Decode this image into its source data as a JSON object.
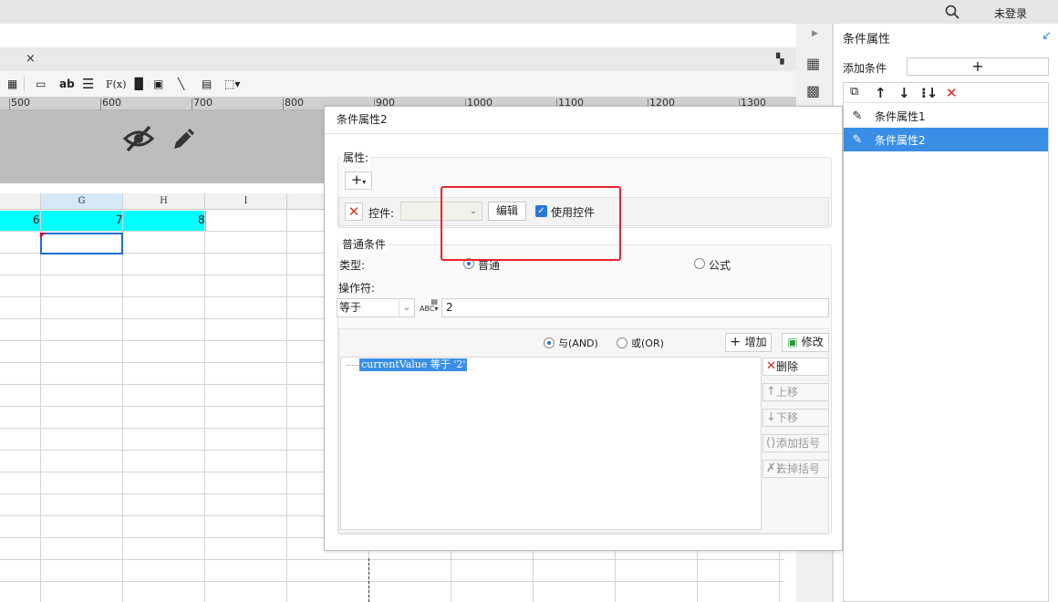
{
  "topbar": {
    "login_label": "未登录"
  },
  "ruler": {
    "ticks": [
      "500",
      "600",
      "700",
      "800",
      "900",
      "1000",
      "1100",
      "1200",
      "1300"
    ]
  },
  "grid": {
    "columns": [
      "",
      "G",
      "H",
      "I"
    ],
    "cyan_values": [
      "6",
      "7",
      "8"
    ]
  },
  "panel": {
    "title": "条件属性",
    "add_condition_label": "添加条件",
    "add_button": "+",
    "items": [
      {
        "label": "条件属性1",
        "active": false
      },
      {
        "label": "条件属性2",
        "active": true
      }
    ]
  },
  "dialog": {
    "title": "条件属性2",
    "attributes_section": "属性:",
    "plus_button": "+",
    "control_label": "控件:",
    "edit_button": "编辑",
    "use_control_label": "使用控件",
    "normal_section": "普通条件",
    "type_label": "类型:",
    "type_options": [
      "普通",
      "公式"
    ],
    "operator_label": "操作符:",
    "operator_value": "等于",
    "value_input": "2",
    "and_label": "与(AND)",
    "or_label": "或(OR)",
    "add_button": "增加",
    "modify_button": "修改",
    "condition_item": "currentValue 等于 '2'",
    "side_buttons": [
      "删除",
      "上移",
      "下移",
      "添加括号",
      "去掉括号"
    ]
  },
  "colors": {
    "accent": "#3a8ee6",
    "highlight_row": "#00ffff",
    "annotation": "#e8242a"
  }
}
